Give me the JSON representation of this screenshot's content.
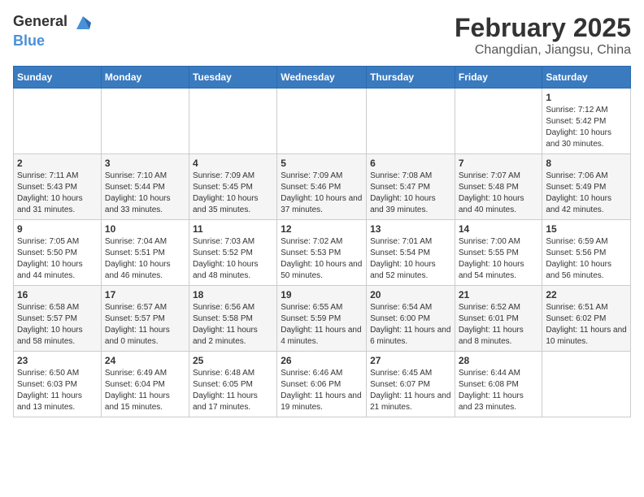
{
  "header": {
    "logo_general": "General",
    "logo_blue": "Blue",
    "month": "February 2025",
    "location": "Changdian, Jiangsu, China"
  },
  "days_of_week": [
    "Sunday",
    "Monday",
    "Tuesday",
    "Wednesday",
    "Thursday",
    "Friday",
    "Saturday"
  ],
  "weeks": [
    [
      {
        "day": "",
        "info": ""
      },
      {
        "day": "",
        "info": ""
      },
      {
        "day": "",
        "info": ""
      },
      {
        "day": "",
        "info": ""
      },
      {
        "day": "",
        "info": ""
      },
      {
        "day": "",
        "info": ""
      },
      {
        "day": "1",
        "info": "Sunrise: 7:12 AM\nSunset: 5:42 PM\nDaylight: 10 hours and 30 minutes."
      }
    ],
    [
      {
        "day": "2",
        "info": "Sunrise: 7:11 AM\nSunset: 5:43 PM\nDaylight: 10 hours and 31 minutes."
      },
      {
        "day": "3",
        "info": "Sunrise: 7:10 AM\nSunset: 5:44 PM\nDaylight: 10 hours and 33 minutes."
      },
      {
        "day": "4",
        "info": "Sunrise: 7:09 AM\nSunset: 5:45 PM\nDaylight: 10 hours and 35 minutes."
      },
      {
        "day": "5",
        "info": "Sunrise: 7:09 AM\nSunset: 5:46 PM\nDaylight: 10 hours and 37 minutes."
      },
      {
        "day": "6",
        "info": "Sunrise: 7:08 AM\nSunset: 5:47 PM\nDaylight: 10 hours and 39 minutes."
      },
      {
        "day": "7",
        "info": "Sunrise: 7:07 AM\nSunset: 5:48 PM\nDaylight: 10 hours and 40 minutes."
      },
      {
        "day": "8",
        "info": "Sunrise: 7:06 AM\nSunset: 5:49 PM\nDaylight: 10 hours and 42 minutes."
      }
    ],
    [
      {
        "day": "9",
        "info": "Sunrise: 7:05 AM\nSunset: 5:50 PM\nDaylight: 10 hours and 44 minutes."
      },
      {
        "day": "10",
        "info": "Sunrise: 7:04 AM\nSunset: 5:51 PM\nDaylight: 10 hours and 46 minutes."
      },
      {
        "day": "11",
        "info": "Sunrise: 7:03 AM\nSunset: 5:52 PM\nDaylight: 10 hours and 48 minutes."
      },
      {
        "day": "12",
        "info": "Sunrise: 7:02 AM\nSunset: 5:53 PM\nDaylight: 10 hours and 50 minutes."
      },
      {
        "day": "13",
        "info": "Sunrise: 7:01 AM\nSunset: 5:54 PM\nDaylight: 10 hours and 52 minutes."
      },
      {
        "day": "14",
        "info": "Sunrise: 7:00 AM\nSunset: 5:55 PM\nDaylight: 10 hours and 54 minutes."
      },
      {
        "day": "15",
        "info": "Sunrise: 6:59 AM\nSunset: 5:56 PM\nDaylight: 10 hours and 56 minutes."
      }
    ],
    [
      {
        "day": "16",
        "info": "Sunrise: 6:58 AM\nSunset: 5:57 PM\nDaylight: 10 hours and 58 minutes."
      },
      {
        "day": "17",
        "info": "Sunrise: 6:57 AM\nSunset: 5:57 PM\nDaylight: 11 hours and 0 minutes."
      },
      {
        "day": "18",
        "info": "Sunrise: 6:56 AM\nSunset: 5:58 PM\nDaylight: 11 hours and 2 minutes."
      },
      {
        "day": "19",
        "info": "Sunrise: 6:55 AM\nSunset: 5:59 PM\nDaylight: 11 hours and 4 minutes."
      },
      {
        "day": "20",
        "info": "Sunrise: 6:54 AM\nSunset: 6:00 PM\nDaylight: 11 hours and 6 minutes."
      },
      {
        "day": "21",
        "info": "Sunrise: 6:52 AM\nSunset: 6:01 PM\nDaylight: 11 hours and 8 minutes."
      },
      {
        "day": "22",
        "info": "Sunrise: 6:51 AM\nSunset: 6:02 PM\nDaylight: 11 hours and 10 minutes."
      }
    ],
    [
      {
        "day": "23",
        "info": "Sunrise: 6:50 AM\nSunset: 6:03 PM\nDaylight: 11 hours and 13 minutes."
      },
      {
        "day": "24",
        "info": "Sunrise: 6:49 AM\nSunset: 6:04 PM\nDaylight: 11 hours and 15 minutes."
      },
      {
        "day": "25",
        "info": "Sunrise: 6:48 AM\nSunset: 6:05 PM\nDaylight: 11 hours and 17 minutes."
      },
      {
        "day": "26",
        "info": "Sunrise: 6:46 AM\nSunset: 6:06 PM\nDaylight: 11 hours and 19 minutes."
      },
      {
        "day": "27",
        "info": "Sunrise: 6:45 AM\nSunset: 6:07 PM\nDaylight: 11 hours and 21 minutes."
      },
      {
        "day": "28",
        "info": "Sunrise: 6:44 AM\nSunset: 6:08 PM\nDaylight: 11 hours and 23 minutes."
      },
      {
        "day": "",
        "info": ""
      }
    ]
  ]
}
